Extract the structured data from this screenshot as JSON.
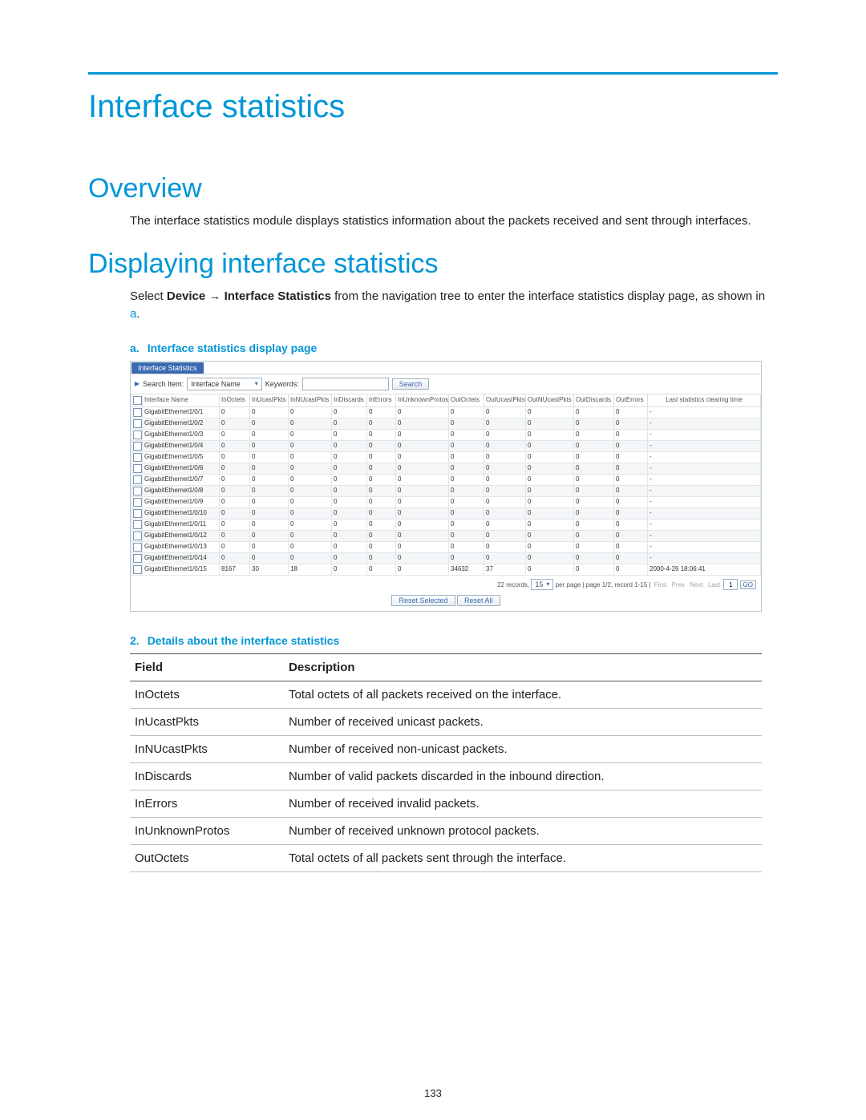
{
  "pageNumber": "133",
  "title": "Interface statistics",
  "overview": {
    "heading": "Overview",
    "text": "The interface statistics module displays statistics information about the packets received and sent through interfaces."
  },
  "display": {
    "heading": "Displaying interface statistics",
    "text_pre": "Select ",
    "nav_device": "Device",
    "nav_arrow": "→",
    "nav_stats": "Interface Statistics",
    "text_mid": " from the navigation tree to enter the interface statistics display page, as shown in ",
    "ref_a": "a",
    "text_end": "."
  },
  "caption_a": {
    "prefix": "a.",
    "text": "Interface statistics display page"
  },
  "ui": {
    "tab": "Interface Statistics",
    "search_label": "Search Item:",
    "search_select": "Interface Name",
    "keywords_label": "Keywords:",
    "keywords_value": "",
    "search_btn": "Search",
    "cols": [
      "",
      "Interface Name",
      "InOctets",
      "InUcastPkts",
      "InNUcastPkts",
      "InDiscards",
      "InErrors",
      "InUnknownProtos",
      "OutOctets",
      "OutUcastPkts",
      "OutNUcastPkts",
      "OutDiscards",
      "OutErrors",
      "Last statistics clearing time"
    ],
    "rows": [
      {
        "name": "GigabitEthernet1/0/1",
        "v": [
          "0",
          "0",
          "0",
          "0",
          "0",
          "0",
          "0",
          "0",
          "0",
          "0",
          "0",
          "-"
        ]
      },
      {
        "name": "GigabitEthernet1/0/2",
        "v": [
          "0",
          "0",
          "0",
          "0",
          "0",
          "0",
          "0",
          "0",
          "0",
          "0",
          "0",
          "-"
        ]
      },
      {
        "name": "GigabitEthernet1/0/3",
        "v": [
          "0",
          "0",
          "0",
          "0",
          "0",
          "0",
          "0",
          "0",
          "0",
          "0",
          "0",
          "-"
        ]
      },
      {
        "name": "GigabitEthernet1/0/4",
        "v": [
          "0",
          "0",
          "0",
          "0",
          "0",
          "0",
          "0",
          "0",
          "0",
          "0",
          "0",
          "-"
        ]
      },
      {
        "name": "GigabitEthernet1/0/5",
        "v": [
          "0",
          "0",
          "0",
          "0",
          "0",
          "0",
          "0",
          "0",
          "0",
          "0",
          "0",
          "-"
        ]
      },
      {
        "name": "GigabitEthernet1/0/6",
        "v": [
          "0",
          "0",
          "0",
          "0",
          "0",
          "0",
          "0",
          "0",
          "0",
          "0",
          "0",
          "-"
        ]
      },
      {
        "name": "GigabitEthernet1/0/7",
        "v": [
          "0",
          "0",
          "0",
          "0",
          "0",
          "0",
          "0",
          "0",
          "0",
          "0",
          "0",
          "-"
        ]
      },
      {
        "name": "GigabitEthernet1/0/8",
        "v": [
          "0",
          "0",
          "0",
          "0",
          "0",
          "0",
          "0",
          "0",
          "0",
          "0",
          "0",
          "-"
        ]
      },
      {
        "name": "GigabitEthernet1/0/9",
        "v": [
          "0",
          "0",
          "0",
          "0",
          "0",
          "0",
          "0",
          "0",
          "0",
          "0",
          "0",
          "-"
        ]
      },
      {
        "name": "GigabitEthernet1/0/10",
        "v": [
          "0",
          "0",
          "0",
          "0",
          "0",
          "0",
          "0",
          "0",
          "0",
          "0",
          "0",
          "-"
        ]
      },
      {
        "name": "GigabitEthernet1/0/11",
        "v": [
          "0",
          "0",
          "0",
          "0",
          "0",
          "0",
          "0",
          "0",
          "0",
          "0",
          "0",
          "-"
        ]
      },
      {
        "name": "GigabitEthernet1/0/12",
        "v": [
          "0",
          "0",
          "0",
          "0",
          "0",
          "0",
          "0",
          "0",
          "0",
          "0",
          "0",
          "-"
        ]
      },
      {
        "name": "GigabitEthernet1/0/13",
        "v": [
          "0",
          "0",
          "0",
          "0",
          "0",
          "0",
          "0",
          "0",
          "0",
          "0",
          "0",
          "-"
        ]
      },
      {
        "name": "GigabitEthernet1/0/14",
        "v": [
          "0",
          "0",
          "0",
          "0",
          "0",
          "0",
          "0",
          "0",
          "0",
          "0",
          "0",
          "-"
        ]
      },
      {
        "name": "GigabitEthernet1/0/15",
        "v": [
          "8167",
          "30",
          "18",
          "0",
          "0",
          "0",
          "34632",
          "37",
          "0",
          "0",
          "0",
          "2000-4-26 18:06:41"
        ]
      }
    ],
    "pager": {
      "records_label_pre": "22 records,",
      "per_page_value": "15",
      "records_label_post": "per page | page 1/2, record 1-15 |",
      "first": "First",
      "prev": "Prev",
      "next": "Next",
      "last": "Last",
      "page_input": "1",
      "go": "GO"
    },
    "reset_selected": "Reset Selected",
    "reset_all": "Reset All"
  },
  "caption_2": {
    "prefix": "2.",
    "text": "Details about the interface statistics"
  },
  "details": {
    "head_field": "Field",
    "head_desc": "Description",
    "rows": [
      {
        "f": "InOctets",
        "d": "Total octets of all packets received on the interface."
      },
      {
        "f": "InUcastPkts",
        "d": "Number of received unicast packets."
      },
      {
        "f": "InNUcastPkts",
        "d": "Number of received non-unicast packets."
      },
      {
        "f": "InDiscards",
        "d": "Number of valid packets discarded in the inbound direction."
      },
      {
        "f": "InErrors",
        "d": "Number of received invalid packets."
      },
      {
        "f": "InUnknownProtos",
        "d": "Number of received unknown protocol packets."
      },
      {
        "f": "OutOctets",
        "d": "Total octets of all packets sent through the interface."
      }
    ]
  }
}
